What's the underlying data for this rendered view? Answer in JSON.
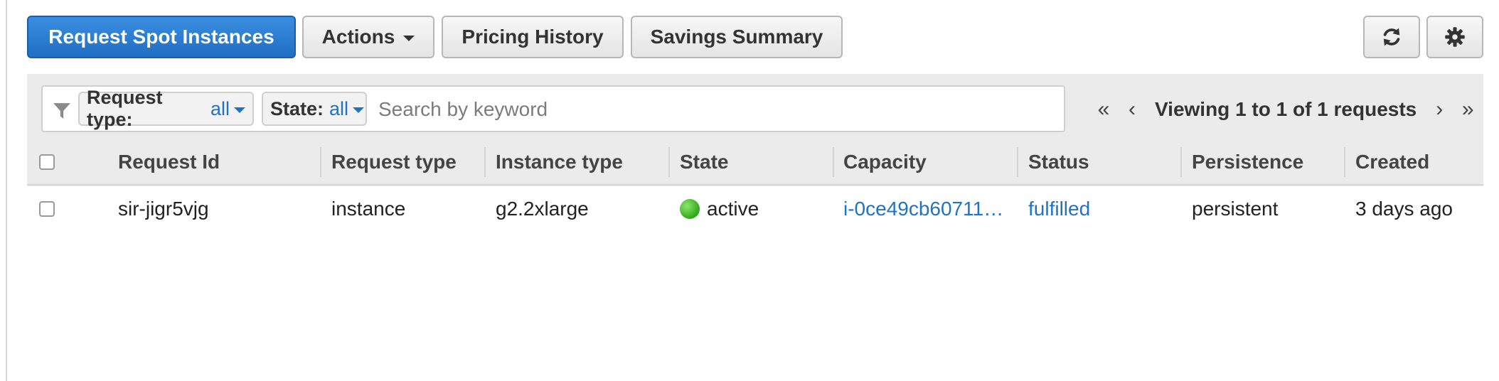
{
  "toolbar": {
    "request_button": "Request Spot Instances",
    "actions_button": "Actions",
    "pricing_history_button": "Pricing History",
    "savings_summary_button": "Savings Summary",
    "refresh_icon": "refresh-icon",
    "settings_icon": "gear-icon"
  },
  "filters": {
    "request_type": {
      "label": "Request type:",
      "value": "all"
    },
    "state": {
      "label": "State:",
      "value": "all"
    },
    "search": {
      "placeholder": "Search by keyword",
      "value": ""
    }
  },
  "pagination": {
    "text": "Viewing 1 to 1 of 1 requests",
    "first": "«",
    "prev": "‹",
    "next": "›",
    "last": "»"
  },
  "table": {
    "columns": [
      "Request Id",
      "Request type",
      "Instance type",
      "State",
      "Capacity",
      "Status",
      "Persistence",
      "Created"
    ],
    "rows": [
      {
        "request_id": "sir-jigr5vjg",
        "request_type": "instance",
        "instance_type": "g2.2xlarge",
        "state": "active",
        "capacity": "i-0ce49cb60711…",
        "status": "fulfilled",
        "persistence": "persistent",
        "created": "3 days ago"
      }
    ]
  },
  "colors": {
    "primary": "#1f6fc4",
    "link": "#1f73c4",
    "active_dot": "#2fa81a"
  }
}
